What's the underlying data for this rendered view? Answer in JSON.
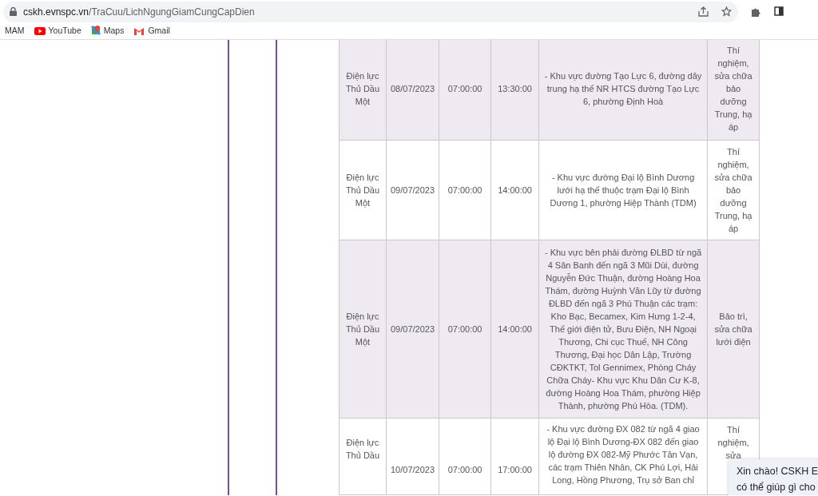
{
  "browser": {
    "url_host": "cskh.evnspc.vn",
    "url_path": "/TraCuu/LichNgungGiamCungCapDien",
    "bookmarks": [
      {
        "kind": "text",
        "label": "MAM"
      },
      {
        "kind": "youtube",
        "label": "YouTube"
      },
      {
        "kind": "maps",
        "label": "Maps"
      },
      {
        "kind": "gmail",
        "label": "Gmail"
      }
    ]
  },
  "table": {
    "rows": [
      {
        "shaded": true,
        "unit": "Điện lực Thủ Dầu Một",
        "date": "08/07/2023",
        "start": "07:00:00",
        "end": "13:30:00",
        "area": "- Khu vực đường Tạo Lực 6, đường dây trung hạ thế NR HTCS đường Tạo Lực 6, phường Định Hoà",
        "reason": "Thí nghiệm, sửa chữa bảo dưỡng Trung, hạ áp"
      },
      {
        "shaded": false,
        "unit": "Điện lực Thủ Dầu Một",
        "date": "09/07/2023",
        "start": "07:00:00",
        "end": "14:00:00",
        "area": "- Khu vực đường Đại lộ Bình Dương lưới hạ thế thuộc trạm Đại lộ Bình Dương 1, phường Hiệp Thành (TDM)",
        "reason": "Thí nghiệm, sửa chữa bảo dưỡng Trung, hạ áp"
      },
      {
        "shaded": true,
        "unit": "Điện lực Thủ Dầu Một",
        "date": "09/07/2023",
        "start": "07:00:00",
        "end": "14:00:00",
        "area": "- Khu vực bên phải đường ĐLBD từ ngã 4 Sân Banh đến ngã 3 Mũi Dùi, đường Nguyễn Đức Thuận, đường Hoàng Hoa Thám, đường Huỳnh Văn Lũy từ đường ĐLBD đến ngã 3 Phú Thuận các trạm: Kho Bạc, Becamex, Kim Hưng 1-2-4, Thế giới điện tử, Bưu Điện, NH Ngoại Thương, Chi cục Thuế, NH Công Thương, Đại học Dân Lập, Trường CĐKTKT, Tol Gennimex, Phòng Cháy Chữa Cháy- Khu vực Khu Dân Cư K-8, đường Hoàng Hoa Thám, phường Hiệp Thành, phường Phú Hòa. (TDM).",
        "reason": "Bảo trì, sửa chữa lưới điện"
      },
      {
        "shaded": false,
        "unit": "Điện lực Thủ Dầu",
        "date": "10/07/2023",
        "start": "07:00:00",
        "end": "17:00:00",
        "area": "- Khu vực đường ĐX 082 từ ngã 4 giao lộ Đại lộ Bình Dương-ĐX 082 đến giao lộ đường ĐX 082-Mỹ Phước Tân Vạn, các trạm Thiên Nhân, CK Phú Lợi, Hải Long, Hồng Phương, Trụ sở Ban chỉ",
        "reason": "Thí nghiệm, sửa"
      }
    ]
  },
  "chat": {
    "lines": [
      "Xin chào! CSKH E",
      "có thể giúp gì cho"
    ]
  }
}
